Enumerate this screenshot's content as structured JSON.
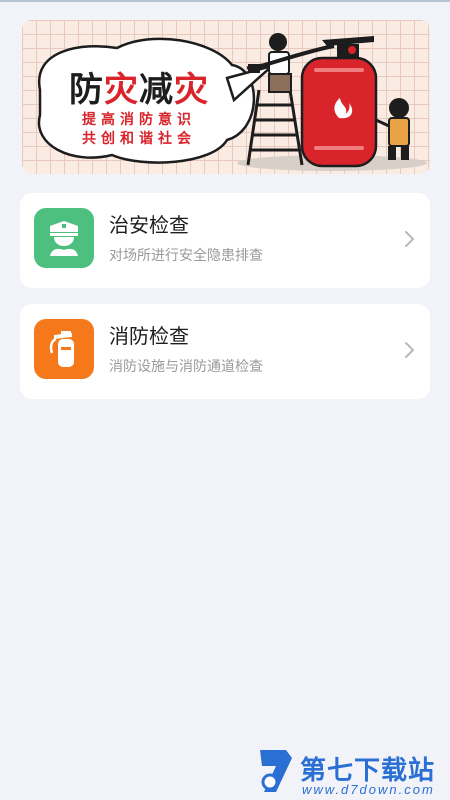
{
  "banner": {
    "title_part1": "防",
    "title_part2": "灾",
    "title_part3": "减",
    "title_part4": "灾",
    "slogan_line1": "提高消防意识",
    "slogan_line2": "共创和谐社会"
  },
  "cards": [
    {
      "title": "治安检查",
      "subtitle": "对场所进行安全隐患排查",
      "icon": "police-officer-icon",
      "color": "#4dbf7e"
    },
    {
      "title": "消防检查",
      "subtitle": "消防设施与消防通道检查",
      "icon": "fire-extinguisher-icon",
      "color": "#f5791b"
    }
  ],
  "watermark": {
    "text": "第七下载站",
    "url": "www.d7down.com"
  }
}
